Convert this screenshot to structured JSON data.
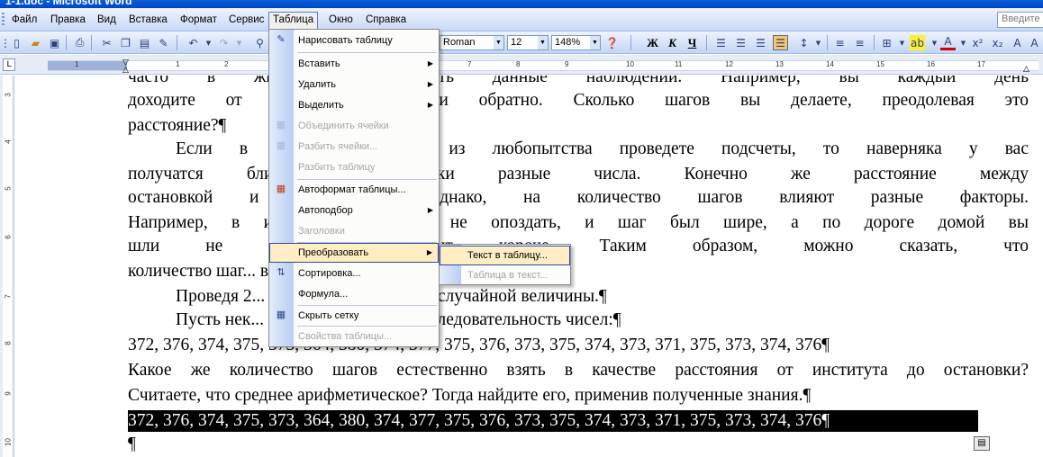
{
  "window": {
    "title": "1-1.doc - Microsoft Word"
  },
  "menubar": {
    "items": [
      "Файл",
      "Правка",
      "Вид",
      "Вставка",
      "Формат",
      "Сервис",
      "Таблица",
      "Окно",
      "Справка"
    ],
    "help_placeholder": "Введите"
  },
  "toolbar": {
    "font_name": "Roman",
    "font_size": "12",
    "zoom": "148%",
    "bold": "Ж",
    "italic": "К",
    "underline": "Ч"
  },
  "ruler": {
    "numbers": [
      "1",
      "1",
      "2",
      "3",
      "4",
      "5",
      "6",
      "7",
      "8",
      "9",
      "10",
      "11",
      "12",
      "13",
      "14",
      "15",
      "16",
      "17"
    ],
    "vertical_numbers": [
      "3",
      "4",
      "5",
      "6",
      "7",
      "8",
      "9",
      "10"
    ]
  },
  "table_menu": {
    "items": [
      {
        "label": "Нарисовать таблицу",
        "icon": "pencil-icon",
        "enabled": true
      },
      {
        "label": "Вставить",
        "submenu": true,
        "enabled": true
      },
      {
        "label": "Удалить",
        "submenu": true,
        "enabled": true
      },
      {
        "label": "Выделить",
        "submenu": true,
        "enabled": true
      },
      {
        "label": "Объединить ячейки",
        "icon": "merge-cells-icon",
        "enabled": false
      },
      {
        "label": "Разбить ячейки...",
        "icon": "split-cells-icon",
        "enabled": false
      },
      {
        "label": "Разбить таблицу",
        "enabled": false
      },
      {
        "label": "Автоформат таблицы...",
        "icon": "autoformat-icon",
        "enabled": true
      },
      {
        "label": "Автоподбор",
        "submenu": true,
        "enabled": true
      },
      {
        "label": "Заголовки",
        "enabled": false
      },
      {
        "label": "Преобразовать",
        "submenu": true,
        "enabled": true,
        "highlighted": true
      },
      {
        "label": "Сортировка...",
        "icon": "sort-icon",
        "enabled": true
      },
      {
        "label": "Формула...",
        "enabled": true
      },
      {
        "label": "Скрыть сетку",
        "icon": "grid-icon",
        "enabled": true
      },
      {
        "label": "Свойства таблицы...",
        "enabled": false
      }
    ]
  },
  "convert_submenu": {
    "items": [
      {
        "label": "Текст в таблицу...",
        "enabled": true,
        "highlighted": true
      },
      {
        "label": "Таблица в текст...",
        "enabled": false
      }
    ]
  },
  "document": {
    "lines": [
      "часто в жизни... обрабатывать данные наблюдений. Например, вы каждый день",
      "доходите от ос... института и обратно. Сколько шагов вы делаете, преодолевая это",
      "расстояние?¶",
      "Если в теч... дней вы из любопытства проведете подсчеты, то наверняка у вас",
      "получатся бли... но все-таки разные числа. Конечно же расстояние между",
      "остановкой и и... ется. Однако, на количество шагов влияют разные факторы.",
      "Например, в ин... стро, чтобы не опоздать, и шаг был шире, а по дороге домой вы",
      "шли не спеша, ... быт короче. Таким образом, можно сказать, что",
      "количество шаг... вки – величина случайная.¶",
      "Проведя 2... получите 20 значений случайной величины.¶",
      "Пусть нек... лучит следующую последовательность чисел:¶",
      "372, 376, 374, 375, 373, 364, 380, 374, 377, 375, 376, 373, 375, 374, 373, 371, 375, 373, 374, 376¶",
      "Какое же количество шагов естественно взять в качестве расстояния от института до остановки?",
      "Считаете, что среднее арифметическое? Тогда найдите его, применив полученные знания.¶",
      "372, 376, 374, 375, 373, 364, 380, 374, 377, 375, 376, 373, 375, 374, 373, 371, 375, 373, 374, 376¶",
      "¶"
    ]
  }
}
